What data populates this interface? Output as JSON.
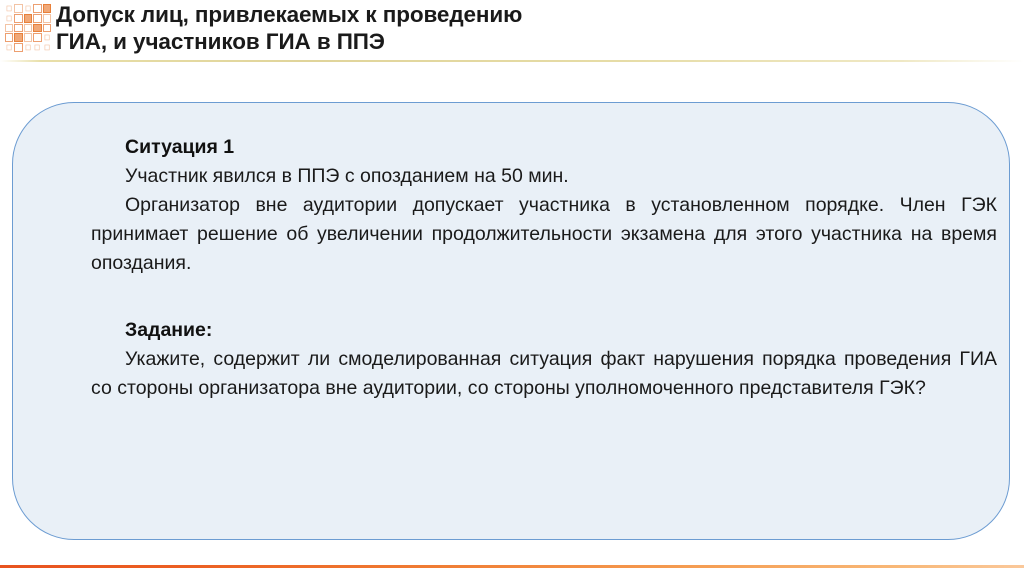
{
  "header": {
    "logo_name": "orange-square-grid-logo",
    "title_line1": "Допуск лиц, привлекаемых к проведению",
    "title_line2": "ГИА, и участников ГИА в ППЭ"
  },
  "card": {
    "situation_heading": "Ситуация 1",
    "situation_line1": "Участник явился в ППЭ с опозданием на 50 мин.",
    "situation_line2": "Организатор вне аудитории допускает участника в установленном порядке. Член ГЭК принимает решение об увеличении продолжительности экзамена для этого участника на время опоздания.",
    "task_heading": "Задание:",
    "task_text": "Укажите, содержит ли смоделированная ситуация факт нарушения порядка проведения ГИА со стороны организатора вне аудитории, со стороны уполномоченного представителя ГЭК?"
  },
  "colors": {
    "card_fill": "#e9f0f7",
    "card_border": "#6c9cd2",
    "accent_orange": "#e8531f",
    "header_rule": "#e0d49a",
    "text": "#1a1a1a"
  }
}
